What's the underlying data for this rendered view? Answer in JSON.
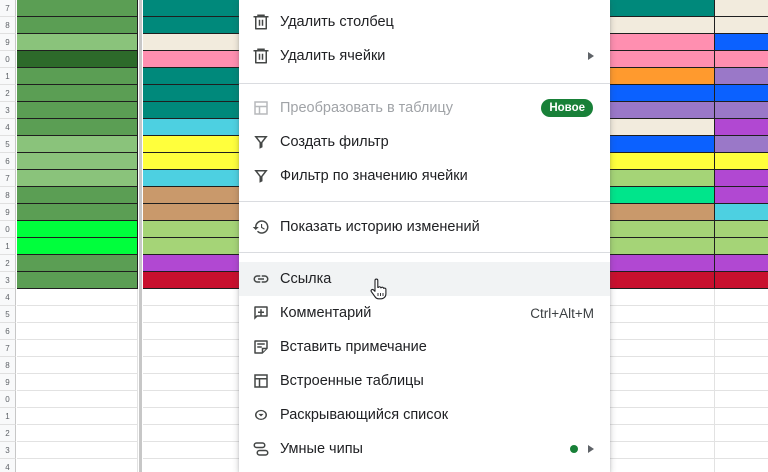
{
  "sheet": {
    "row_numbers": [
      "7",
      "8",
      "9",
      "0",
      "1",
      "2",
      "3",
      "4",
      "5",
      "6",
      "7",
      "8",
      "9",
      "0",
      "1",
      "2",
      "3",
      "4",
      "5",
      "6",
      "7",
      "8",
      "9",
      "0",
      "1",
      "2",
      "3",
      "4"
    ],
    "colors": {
      "col_b": [
        "#5b9e54",
        "#5b9e54",
        "#8ac37b",
        "#2d6a2a",
        "#5b9e54",
        "#5b9e54",
        "#5b9e54",
        "#5b9e54",
        "#8ac37b",
        "#8ac37b",
        "#8ac37b",
        "#5b9e54",
        "#5b9e54",
        "#00ff3c",
        "#00ff3c",
        "#5b9e54",
        "#5b9e54"
      ],
      "col_c": [
        "#00897b",
        "#00897b",
        "#f2ebdd",
        "#ff8fb0",
        "#00897b",
        "#00897b",
        "#00897b",
        "#4dd0e1",
        "#ffff3c",
        "#ffff3c",
        "#4dd0e1",
        "#c9996b",
        "#c9996b",
        "#a5d477",
        "#a5d477",
        "#b148d2",
        "#c8102e"
      ],
      "col_d": [
        "#00897b",
        "#f2ebdd",
        "#ff8fb0",
        "#ff8fb0",
        "#ff9a2e",
        "#0b61ff",
        "#9a78c8",
        "#f2ebdd",
        "#0b61ff",
        "#ffff3c",
        "#a5d477",
        "#00e58b",
        "#c9996b",
        "#a5d477",
        "#a5d477",
        "#b148d2",
        "#c8102e"
      ],
      "col_e": [
        "#f2ebdd",
        "#f2ebdd",
        "#0b61ff",
        "#ff8fb0",
        "#9a78c8",
        "#0b61ff",
        "#9a78c8",
        "#b148d2",
        "#9a78c8",
        "#ffff3c",
        "#b148d2",
        "#b148d2",
        "#4dd0e1",
        "#a5d477",
        "#a5d477",
        "#b148d2",
        "#c8102e"
      ]
    }
  },
  "menu": {
    "items": [
      {
        "label": "Удалить столбец",
        "icon": "trash-icon"
      },
      {
        "label": "Удалить ячейки",
        "icon": "trash-icon",
        "submenu": true
      },
      {
        "label": "Преобразовать в таблицу",
        "icon": "table-convert-icon",
        "disabled": true,
        "badge": "Новое"
      },
      {
        "label": "Создать фильтр",
        "icon": "filter-icon"
      },
      {
        "label": "Фильтр по значению ячейки",
        "icon": "filter-icon"
      },
      {
        "label": "Показать историю изменений",
        "icon": "history-icon"
      },
      {
        "label": "Ссылка",
        "icon": "link-icon",
        "hovered": true
      },
      {
        "label": "Комментарий",
        "icon": "add-comment-icon",
        "shortcut": "Ctrl+Alt+M"
      },
      {
        "label": "Вставить примечание",
        "icon": "note-icon"
      },
      {
        "label": "Встроенные таблицы",
        "icon": "table-icon"
      },
      {
        "label": "Раскрывающийся список",
        "icon": "dropdown-icon"
      },
      {
        "label": "Умные чипы",
        "icon": "smart-chips-icon",
        "submenu": true,
        "status_dot": true
      }
    ]
  },
  "cursor": "hand-pointer-icon"
}
